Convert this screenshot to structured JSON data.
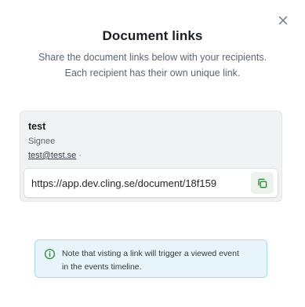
{
  "dialog": {
    "title": "Document links",
    "subtitle_line1": "Share the document links below with your recipients.",
    "subtitle_line2": "Each recipient has their own unique link."
  },
  "recipient": {
    "name": "test",
    "role": "Signee",
    "email": "test@test.se",
    "separator": "·",
    "link": "https://app.dev.cling.se/document/18f159"
  },
  "notice": {
    "line1": "Note that visting a link will trigger a viewed event",
    "line2": "in the events timeline."
  },
  "icons": {
    "close": "close-icon",
    "copy": "copy-icon",
    "info": "info-icon"
  },
  "colors": {
    "copy_accent": "#2f8a3b",
    "info_accent": "#2f8a3b",
    "info_background": "#e7f5fa",
    "info_border": "#a8d9ea"
  }
}
